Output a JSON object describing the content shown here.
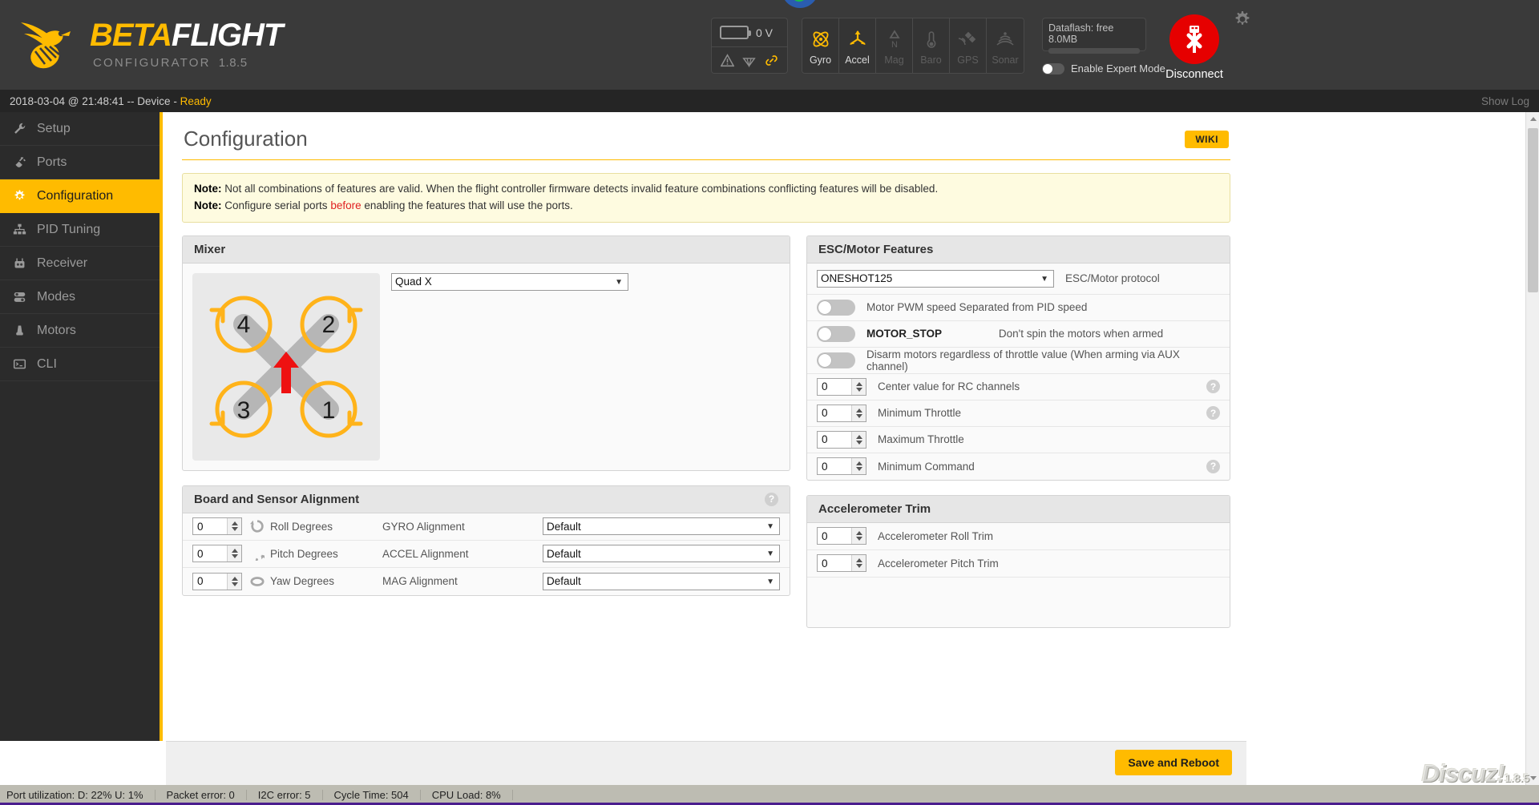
{
  "header": {
    "brand_beta": "BETA",
    "brand_flight": "FLIGHT",
    "subtitle": "CONFIGURATOR",
    "version": "1.8.5",
    "battery_voltage": "0 V",
    "sensors": [
      {
        "label": "Gyro",
        "active": true,
        "icon": "gyro-icon"
      },
      {
        "label": "Accel",
        "active": true,
        "icon": "accel-icon"
      },
      {
        "label": "Mag",
        "active": false,
        "icon": "compass-icon"
      },
      {
        "label": "Baro",
        "active": false,
        "icon": "thermometer-icon"
      },
      {
        "label": "GPS",
        "active": false,
        "icon": "satellite-icon"
      },
      {
        "label": "Sonar",
        "active": false,
        "icon": "sonar-icon"
      }
    ],
    "dataflash_label": "Dataflash: free 8.0MB",
    "expert_mode_label": "Enable Expert Mode",
    "expert_mode_on": false,
    "disconnect_label": "Disconnect",
    "accent_color": "#ffbb00",
    "disconnect_color": "#e60000"
  },
  "status": {
    "timestamp_device": "2018-03-04 @ 21:48:41 -- Device - ",
    "state": "Ready",
    "show_log": "Show Log"
  },
  "sidebar": {
    "items": [
      {
        "label": "Setup",
        "icon": "wrench-icon",
        "active": false
      },
      {
        "label": "Ports",
        "icon": "plug-icon",
        "active": false
      },
      {
        "label": "Configuration",
        "icon": "gear-icon",
        "active": true
      },
      {
        "label": "PID Tuning",
        "icon": "sitemap-icon",
        "active": false
      },
      {
        "label": "Receiver",
        "icon": "transmitter-icon",
        "active": false
      },
      {
        "label": "Modes",
        "icon": "sliders-icon",
        "active": false
      },
      {
        "label": "Motors",
        "icon": "motor-icon",
        "active": false
      },
      {
        "label": "CLI",
        "icon": "terminal-icon",
        "active": false
      }
    ]
  },
  "main": {
    "page_title": "Configuration",
    "wiki_label": "WIKI",
    "notes": {
      "note_label": "Note:",
      "note1": " Not all combinations of features are valid. When the flight controller firmware detects invalid feature combinations conflicting features will be disabled.",
      "note2_pre": " Configure serial ports ",
      "note2_em": "before",
      "note2_post": " enabling the features that will use the ports."
    },
    "mixer": {
      "title": "Mixer",
      "selected": "Quad X",
      "motor_labels": [
        "1",
        "2",
        "3",
        "4"
      ]
    },
    "esc_motor": {
      "title": "ESC/Motor Features",
      "protocol_value": "ONESHOT125",
      "protocol_label": "ESC/Motor protocol",
      "toggles": [
        {
          "label": "Motor PWM speed Separated from PID speed",
          "bold": false,
          "desc": "",
          "on": false
        },
        {
          "label": "MOTOR_STOP",
          "bold": true,
          "desc": "Don't spin the motors when armed",
          "on": false
        },
        {
          "label": "Disarm motors regardless of throttle value (When arming via AUX channel)",
          "bold": false,
          "desc": "",
          "on": false
        }
      ],
      "numbers": [
        {
          "value": "0",
          "label": "Center value for RC channels",
          "help": true
        },
        {
          "value": "0",
          "label": "Minimum Throttle",
          "help": true
        },
        {
          "value": "0",
          "label": "Maximum Throttle",
          "help": false
        },
        {
          "value": "0",
          "label": "Minimum Command",
          "help": true
        }
      ]
    },
    "alignment": {
      "title": "Board and Sensor Alignment",
      "rows": [
        {
          "value": "0",
          "icon": "roll-icon",
          "label": "Roll Degrees",
          "sensor": "GYRO Alignment",
          "select": "Default"
        },
        {
          "value": "0",
          "icon": "pitch-icon",
          "label": "Pitch Degrees",
          "sensor": "ACCEL Alignment",
          "select": "Default"
        },
        {
          "value": "0",
          "icon": "yaw-icon",
          "label": "Yaw Degrees",
          "sensor": "MAG Alignment",
          "select": "Default"
        }
      ]
    },
    "accel_trim": {
      "title": "Accelerometer Trim",
      "rows": [
        {
          "value": "0",
          "label": "Accelerometer Roll Trim"
        },
        {
          "value": "0",
          "label": "Accelerometer Pitch Trim"
        }
      ]
    },
    "save_button": "Save and Reboot"
  },
  "bottom": {
    "cells": [
      "Port utilization: D: 22% U: 1%",
      "Packet error: 0",
      "I2C error: 5",
      "Cycle Time: 504",
      "CPU Load: 8%"
    ],
    "watermark": "Discuz!",
    "watermark_version": "1.8.5"
  }
}
